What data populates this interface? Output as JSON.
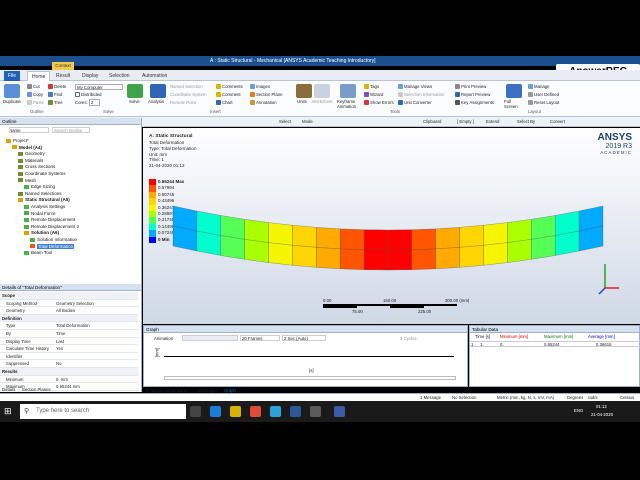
{
  "title_bar": {
    "text": "A : Static Structural - Mechanical [ANSYS Academic Teaching Introductory]",
    "context_tab": "Context"
  },
  "watermark": "ApowerREC",
  "ribbon_tabs": [
    "File",
    "Home",
    "Result",
    "Display",
    "Selection",
    "Automation"
  ],
  "ribbon": {
    "duplicate": "Duplicate",
    "clipboard": [
      "Cut",
      "Copy",
      "Paste"
    ],
    "delete": "Delete",
    "find": "Find",
    "tree": "Tree",
    "my_computer": "My Computer",
    "distributed": "Distributed",
    "cores_label": "Cores:",
    "cores_value": "2",
    "solve": "Solve",
    "analysis": "Analysis",
    "insert_items": [
      "Named Selection",
      "Coordinate System",
      "Remote Point"
    ],
    "comments": "Comments",
    "comment": "Comment",
    "chart": "Chart",
    "images": "Images",
    "section_plane": "Section Plane",
    "annotation": "Annotation",
    "units": "Units",
    "worksheet": "Worksheet",
    "keyframe": "Keyframe Animation",
    "tags": "Tags",
    "wizard": "Wizard",
    "show_errors": "Show Errors",
    "manage_views": "Manage Views",
    "selection_info": "Selection Information",
    "unit_converter": "Unit Converter",
    "print_preview": "Print Preview",
    "report_preview": "Report Preview",
    "key_assignments": "Key Assignments",
    "full_screen": "Full Screen",
    "manage": "Manage",
    "user_defined": "User Defined",
    "reset_layout": "Reset Layout",
    "groups": [
      "Outline",
      "Solve",
      "Insert",
      "Tools",
      "Layout"
    ]
  },
  "toolbar": {
    "select": "Select",
    "mode": "Mode",
    "clipboard": "Clipboard",
    "empty": "[ Empty ]",
    "extend": "Extend",
    "select_by": "Select By",
    "convert": "Convert"
  },
  "outline": {
    "header": "Outline",
    "name_label": "Name",
    "search_placeholder": "Search Outline",
    "items": [
      {
        "label": "Project*",
        "depth": 0,
        "color": "#d9a300"
      },
      {
        "label": "Model (A4)",
        "depth": 1,
        "color": "#d9a300",
        "bold": true
      },
      {
        "label": "Geometry",
        "depth": 2,
        "color": "#6f8f2f"
      },
      {
        "label": "Materials",
        "depth": 2,
        "color": "#6f8f2f"
      },
      {
        "label": "Cross Sections",
        "depth": 2,
        "color": "#6f8f2f"
      },
      {
        "label": "Coordinate Systems",
        "depth": 2,
        "color": "#6f8f2f"
      },
      {
        "label": "Mesh",
        "depth": 2,
        "color": "#6f8f2f"
      },
      {
        "label": "Edge Sizing",
        "depth": 3,
        "color": "#4caf50"
      },
      {
        "label": "Named Selections",
        "depth": 2,
        "color": "#6f8f2f"
      },
      {
        "label": "Static Structural (A5)",
        "depth": 2,
        "color": "#d9a300",
        "bold": true
      },
      {
        "label": "Analysis Settings",
        "depth": 3,
        "color": "#4caf50"
      },
      {
        "label": "Nodal Force",
        "depth": 3,
        "color": "#4caf50"
      },
      {
        "label": "Remote Displacement",
        "depth": 3,
        "color": "#4caf50"
      },
      {
        "label": "Remote Displacement 2",
        "depth": 3,
        "color": "#4caf50"
      },
      {
        "label": "Solution (A6)",
        "depth": 3,
        "color": "#d9a300",
        "bold": true
      },
      {
        "label": "Solution Information",
        "depth": 4,
        "color": "#4caf50"
      },
      {
        "label": "Total Deformation",
        "depth": 4,
        "color": "#e45c1b",
        "selected": true
      },
      {
        "label": "Beam Tool",
        "depth": 3,
        "color": "#4caf50"
      }
    ]
  },
  "details": {
    "header": "Details of \"Total Deformation\"",
    "rows": [
      {
        "k": "Scope",
        "v": "",
        "sec": true
      },
      {
        "k": "Scoping Method",
        "v": "Geometry Selection"
      },
      {
        "k": "Geometry",
        "v": "All Bodies"
      },
      {
        "k": "Definition",
        "v": "",
        "sec": true
      },
      {
        "k": "Type",
        "v": "Total Deformation"
      },
      {
        "k": "By",
        "v": "Time"
      },
      {
        "k": "Display Time",
        "v": "Last"
      },
      {
        "k": "Calculate Time History",
        "v": "Yes"
      },
      {
        "k": "Identifier",
        "v": ""
      },
      {
        "k": "Suppressed",
        "v": "No"
      },
      {
        "k": "Results",
        "v": "",
        "sec": true
      },
      {
        "k": "Minimum",
        "v": "0. mm"
      },
      {
        "k": "Maximum",
        "v": "0.65244 mm"
      }
    ],
    "bottom_tabs": [
      "Details",
      "Section Planes"
    ]
  },
  "viewport": {
    "title": "A: Static Structural",
    "info": [
      "Total Deformation",
      "Type: Total Deformation",
      "Unit: mm",
      "Time: 1",
      "21-04-2020 01:12"
    ],
    "legend": [
      "0.65244 Max",
      "0.57994",
      "0.50745",
      "0.43496",
      "0.36247",
      "0.28997",
      "0.21748",
      "0.14499",
      "0.072494",
      "0 Min"
    ],
    "legend_colors": [
      "#ff0000",
      "#ff5500",
      "#ffaa00",
      "#ffd500",
      "#f5f500",
      "#aaff00",
      "#55ff55",
      "#00ffcc",
      "#00aaff",
      "#0000ff"
    ],
    "logo": "ANSYS",
    "logo_sub": "2019 R3",
    "logo_sub2": "ACADEMIC",
    "scale_top": [
      "0.00",
      "150.00",
      "300.00 (mm)"
    ],
    "scale_bottom": [
      "75.00",
      "225.00"
    ]
  },
  "graph": {
    "header": "Graph",
    "animation": "Animation",
    "frames": "20 Frames",
    "duration": "2 Sec (Auto)",
    "cycles": "3 Cycles",
    "yaxis": "[mm]",
    "xaxis": "[s]",
    "bottom_tabs": [
      "Graphics Annotations",
      "Messages",
      "Graph"
    ]
  },
  "tabular": {
    "header": "Tabular Data",
    "columns": [
      "Time [s]",
      "Minimum [mm]",
      "Maximum [mm]",
      "Average [mm]"
    ],
    "rows": [
      [
        "1",
        "1.",
        "0.",
        "0.65244",
        "0.36615"
      ]
    ]
  },
  "status": {
    "message": "1 Message",
    "selection": "No Selection",
    "units": "Metric (mm, kg, N, s, mV, mA)",
    "degrees": "Degrees",
    "rad": "rad/s",
    "temp": "Celsius"
  },
  "taskbar": {
    "search_placeholder": "Type here to search",
    "time": "01:12",
    "date": "21-04-2020",
    "lang": "ENG"
  }
}
